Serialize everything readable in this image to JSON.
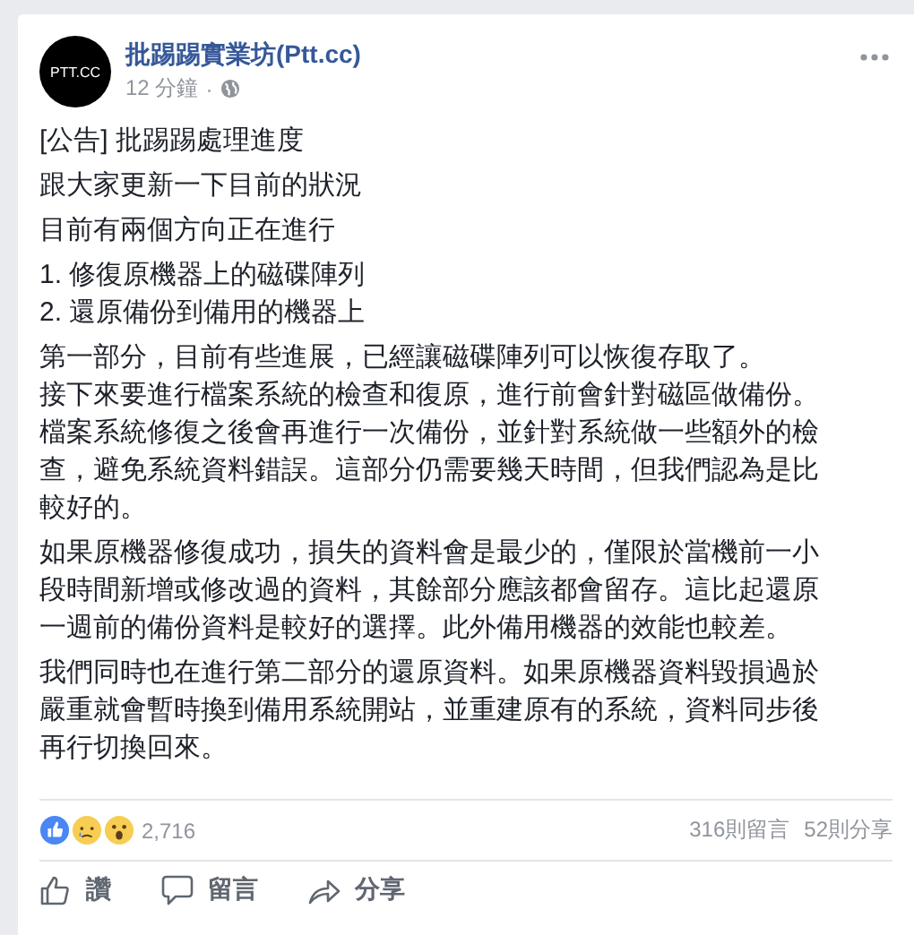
{
  "post": {
    "author": "批踢踢實業坊(Ptt.cc)",
    "avatar_text": "PTT.CC",
    "time": "12 分鐘",
    "separator": "·",
    "body": [
      {
        "kind": "paragraph",
        "text": "[公告] 批踢踢處理進度"
      },
      {
        "kind": "paragraph",
        "text": "跟大家更新一下目前的狀況"
      },
      {
        "kind": "paragraph",
        "text": "目前有兩個方向正在進行"
      },
      {
        "kind": "list",
        "items": [
          "1. 修復原機器上的磁碟陣列",
          "2. 還原備份到備用的機器上"
        ]
      },
      {
        "kind": "lines",
        "lines": [
          "第一部分，目前有些進展，已經讓磁碟陣列可以恢復存取了。",
          "接下來要進行檔案系統的檢查和復原，進行前會針對磁區做備份。",
          "檔案系統修復之後會再進行一次備份，並針對系統做一些額外的檢查，避免系統資料錯誤。這部分仍需要幾天時間，但我們認為是比較好的。"
        ]
      },
      {
        "kind": "paragraph",
        "text": "如果原機器修復成功，損失的資料會是最少的，僅限於當機前一小段時間新增或修改過的資料，其餘部分應該都會留存。這比起還原一週前的備份資料是較好的選擇。此外備用機器的效能也較差。"
      },
      {
        "kind": "paragraph",
        "text": "我們同時也在進行第二部分的還原資料。如果原機器資料毀損過於嚴重就會暫時換到備用系統開站，並重建原有的系統，資料同步後再行切換回來。"
      }
    ],
    "reactions": {
      "count": "2,716",
      "comments": "316則留言",
      "shares": "52則分享"
    },
    "actions": [
      {
        "kind": "like",
        "label": "讚"
      },
      {
        "kind": "comment",
        "label": "留言"
      },
      {
        "kind": "share",
        "label": "分享"
      }
    ]
  }
}
